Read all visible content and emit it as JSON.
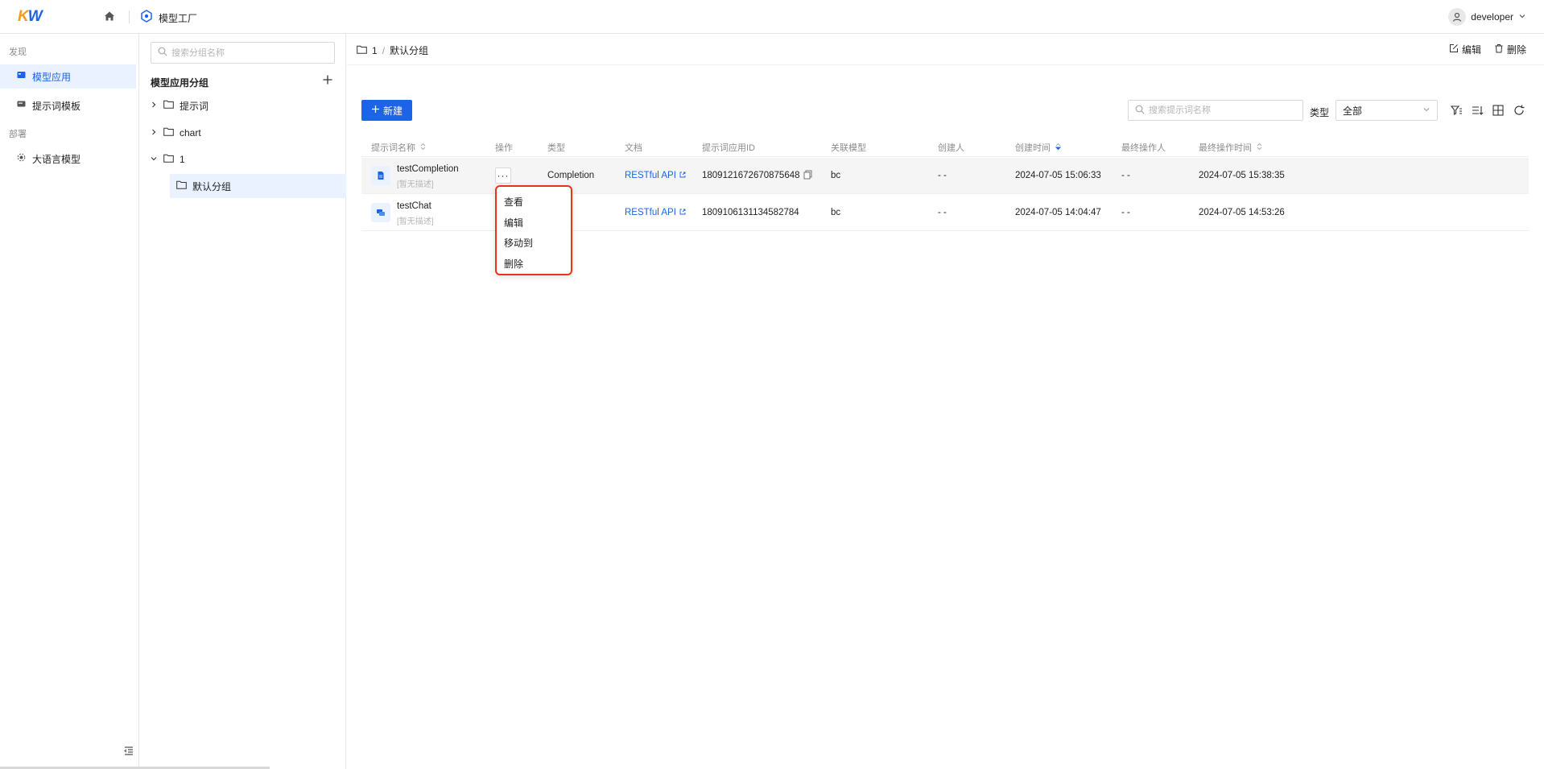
{
  "app": {
    "logo_k": "K",
    "logo_w": "W",
    "product_name": "模型工厂",
    "user_name": "developer"
  },
  "nav": {
    "section_discover": "发现",
    "section_deploy": "部署",
    "items": [
      {
        "label": "模型应用",
        "icon": "app-grid-icon",
        "active": true
      },
      {
        "label": "提示词模板",
        "icon": "template-icon",
        "active": false
      },
      {
        "label": "大语言模型",
        "icon": "llm-icon",
        "active": false
      }
    ]
  },
  "groups": {
    "search_placeholder": "搜索分组名称",
    "title": "模型应用分组",
    "tree": [
      {
        "label": "提示词",
        "expanded": false
      },
      {
        "label": "chart",
        "expanded": false
      },
      {
        "label": "1",
        "expanded": true
      },
      {
        "label": "默认分组",
        "child": true,
        "selected": true
      }
    ]
  },
  "header": {
    "crumb_parent": "1",
    "crumb_sep": "/",
    "crumb_current": "默认分组",
    "edit_label": "编辑",
    "delete_label": "删除"
  },
  "toolbar": {
    "new_label": "新建",
    "search_placeholder": "搜索提示词名称",
    "type_label": "类型",
    "type_value": "全部"
  },
  "table": {
    "columns": {
      "name": "提示词名称",
      "action": "操作",
      "type": "类型",
      "doc": "文档",
      "app_id": "提示词应用ID",
      "model": "关联模型",
      "creator": "创建人",
      "created_at": "创建时间",
      "last_operator": "最终操作人",
      "last_time": "最终操作时间"
    },
    "rows": [
      {
        "name": "testCompletion",
        "desc": "[暂无描述]",
        "more": "···",
        "type": "Completion",
        "doc": "RESTful API",
        "app_id": "1809121672670875648",
        "model": "bc",
        "creator": "- -",
        "created_at": "2024-07-05 15:06:33",
        "last_operator": "- -",
        "last_time": "2024-07-05 15:38:35"
      },
      {
        "name": "testChat",
        "desc": "[暂无描述]",
        "type": "",
        "doc": "RESTful API",
        "app_id": "1809106131134582784",
        "model": "bc",
        "creator": "- -",
        "created_at": "2024-07-05 14:04:47",
        "last_operator": "- -",
        "last_time": "2024-07-05 14:53:26"
      }
    ]
  },
  "context_menu": {
    "items": [
      "查看",
      "编辑",
      "移动到",
      "删除"
    ],
    "highlight_color": "#e8331a"
  },
  "colors": {
    "primary": "#1d63e8",
    "logo_orange": "#f29b1d"
  }
}
